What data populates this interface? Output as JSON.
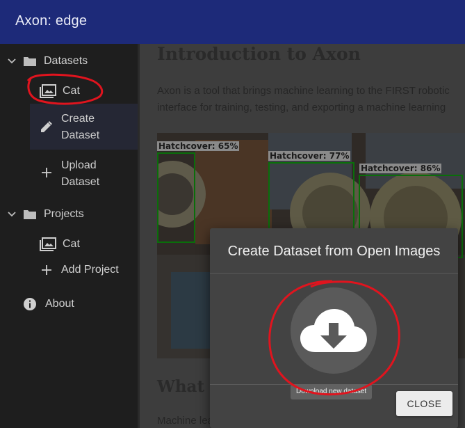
{
  "app": {
    "title": "Axon: edge"
  },
  "sidebar": {
    "datasets": {
      "label": "Datasets",
      "items": [
        {
          "label": "Cat"
        }
      ],
      "create": "Create\nDataset",
      "upload": "Upload\nDataset"
    },
    "projects": {
      "label": "Projects",
      "items": [
        {
          "label": "Cat"
        }
      ],
      "add": "Add Project"
    },
    "about": "About"
  },
  "main": {
    "title": "Introduction to Axon",
    "intro_line1": "Axon is a tool that brings machine learning to the FIRST robotic",
    "intro_line2": "interface for training, testing, and exporting a machine learning",
    "section_title": "What is",
    "body_line": "Machine learning is a new, exciting field of computer science. M",
    "detections": [
      {
        "label": "Hatchcover: 65%"
      },
      {
        "label": "Hatchcover: 77%"
      },
      {
        "label": "Hatchcover: 86%"
      }
    ]
  },
  "dialog": {
    "title": "Create Dataset from Open Images",
    "tooltip": "Download new dataset",
    "close_label": "CLOSE"
  },
  "colors": {
    "appbar": "#1d2a79",
    "sidebar": "#1e1e1e",
    "dialog": "#434343",
    "annotation": "#e0141e"
  }
}
